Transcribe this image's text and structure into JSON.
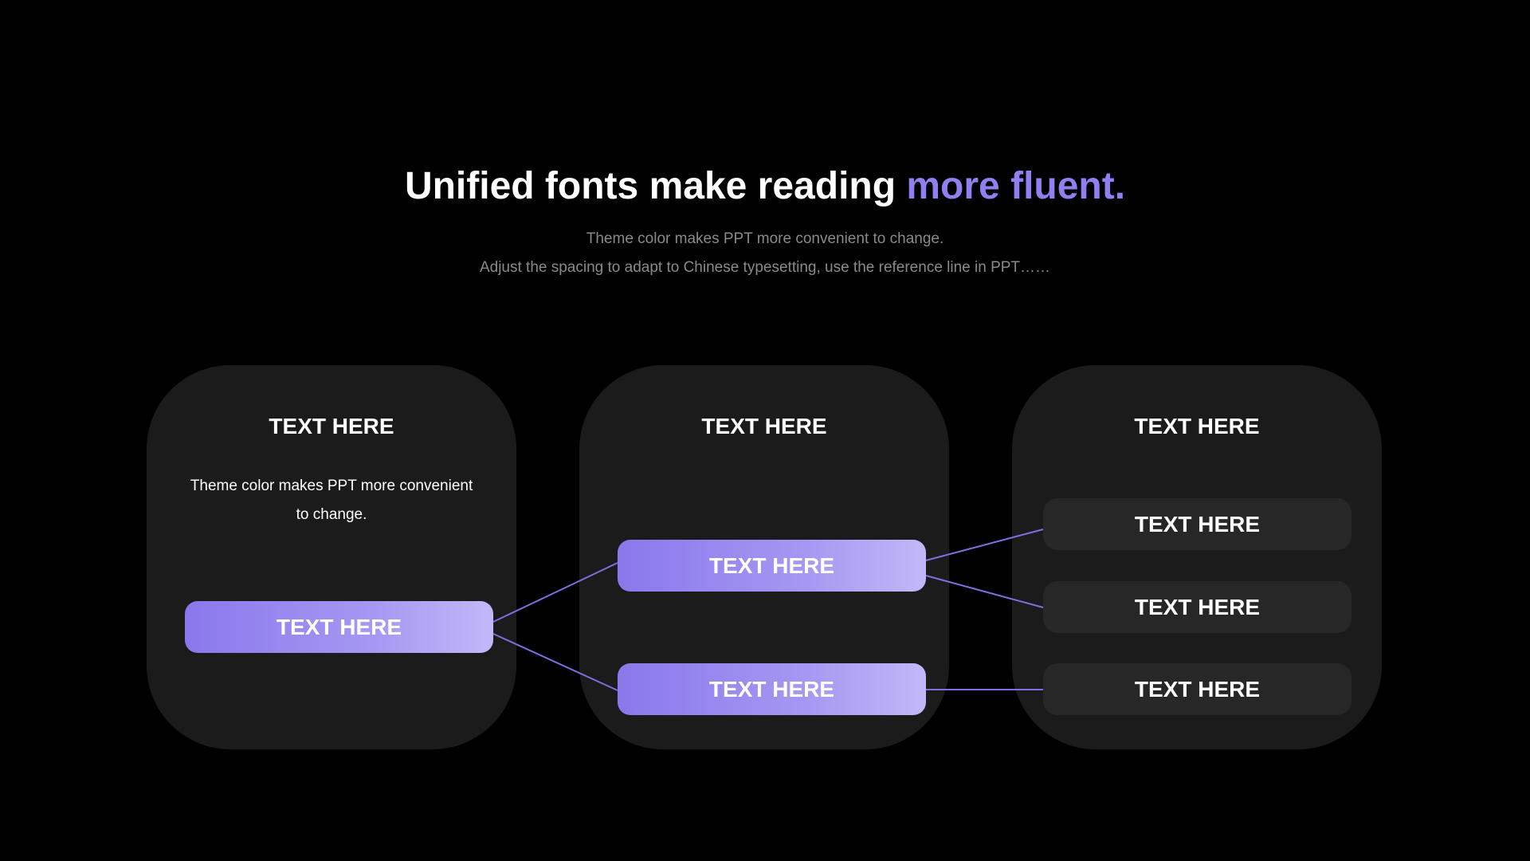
{
  "headline": {
    "main": "Unified fonts make reading ",
    "accent": "more fluent."
  },
  "subtitle": {
    "line1": "Theme color makes PPT more convenient to change.",
    "line2": "Adjust the spacing to adapt to Chinese typesetting, use the reference line in PPT……"
  },
  "panels": [
    {
      "title": "TEXT HERE",
      "description": "Theme color makes PPT more convenient to change.",
      "pills": [
        "TEXT HERE"
      ]
    },
    {
      "title": "TEXT HERE",
      "pills": [
        "TEXT HERE",
        "TEXT HERE"
      ]
    },
    {
      "title": "TEXT HERE",
      "boxes": [
        "TEXT HERE",
        "TEXT HERE",
        "TEXT HERE"
      ]
    }
  ],
  "colors": {
    "background": "#000000",
    "accent": "#8f7ff0",
    "panel": "#1b1b1b",
    "box": "#272727",
    "connector": "#7e6fe0"
  }
}
